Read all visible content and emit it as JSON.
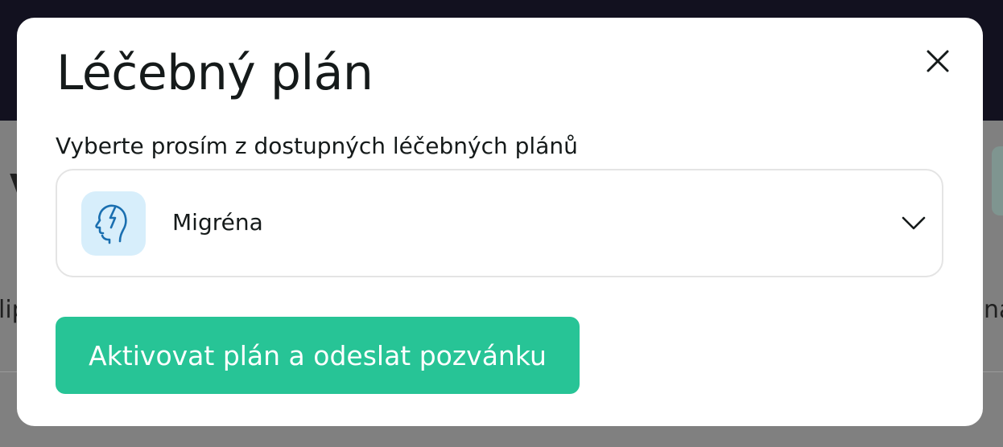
{
  "background": {
    "title_fragment": "V",
    "left_fragment": "lip",
    "right_fragment": "na"
  },
  "modal": {
    "title": "Léčebný plán",
    "close_icon": "close-icon",
    "field_label": "Vyberte prosím z dostupných léčebných plánů",
    "select": {
      "selected_value": "Migréna",
      "icon": "head-lightning-icon",
      "icon_color": "#1a6fb0",
      "icon_background": "#d7eefb",
      "chevron_icon": "chevron-down-icon"
    },
    "primary_button": {
      "label": "Aktivovat plán a odeslat pozvánku",
      "color": "#27c496"
    }
  }
}
